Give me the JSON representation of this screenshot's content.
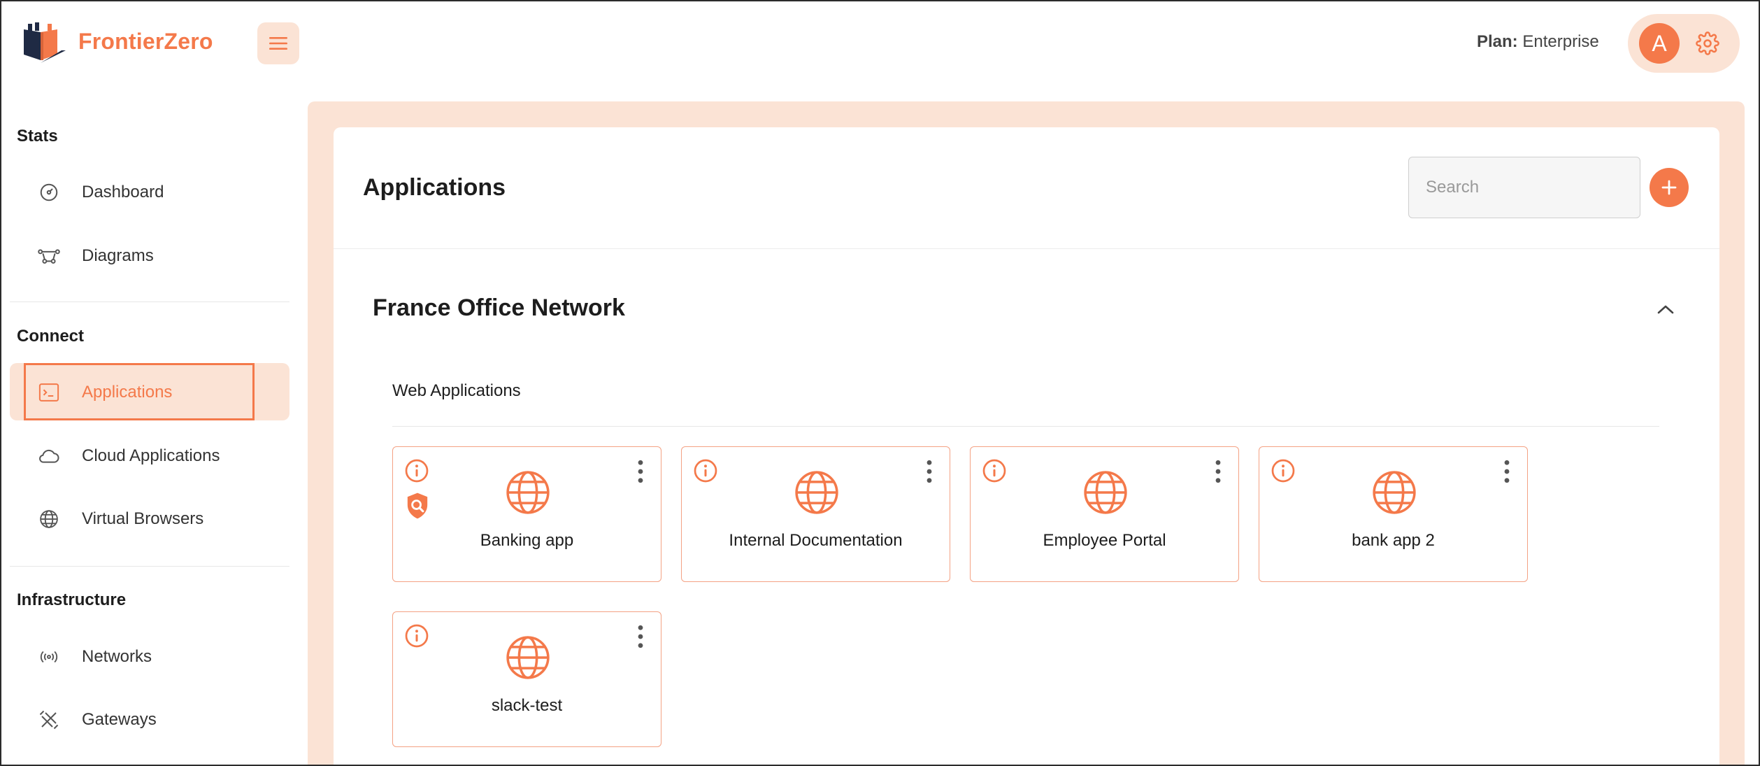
{
  "brand": {
    "name": "FrontierZero",
    "accent": "#f4794a",
    "accent_light": "#fbe3d5"
  },
  "header": {
    "menu_icon": "hamburger-icon",
    "plan_label": "Plan:",
    "plan_value": "Enterprise",
    "avatar_letter": "A",
    "settings_icon": "gear-icon"
  },
  "sidebar": {
    "sections": [
      {
        "title": "Stats"
      },
      {
        "title": "Connect"
      },
      {
        "title": "Infrastructure"
      }
    ],
    "items": [
      {
        "label": "Dashboard",
        "icon": "gauge-icon"
      },
      {
        "label": "Diagrams",
        "icon": "diagram-icon"
      },
      {
        "label": "Applications",
        "icon": "terminal-icon",
        "active": true
      },
      {
        "label": "Cloud Applications",
        "icon": "cloud-icon"
      },
      {
        "label": "Virtual Browsers",
        "icon": "globe-icon"
      },
      {
        "label": "Networks",
        "icon": "broadcast-icon"
      },
      {
        "label": "Gateways",
        "icon": "gateway-icon"
      }
    ]
  },
  "main": {
    "title": "Applications",
    "search": {
      "placeholder": "Search",
      "value": ""
    },
    "add_icon": "plus-icon",
    "group": {
      "title": "France Office Network",
      "collapse_icon": "chevron-up-icon",
      "subsection": "Web Applications",
      "apps": [
        {
          "name": "Banking app",
          "icon": "globe-icon",
          "has_shield": true
        },
        {
          "name": "Internal Documentation",
          "icon": "globe-icon"
        },
        {
          "name": "Employee Portal",
          "icon": "globe-icon"
        },
        {
          "name": "bank app 2",
          "icon": "globe-icon"
        },
        {
          "name": "slack-test",
          "icon": "globe-icon"
        }
      ]
    }
  }
}
